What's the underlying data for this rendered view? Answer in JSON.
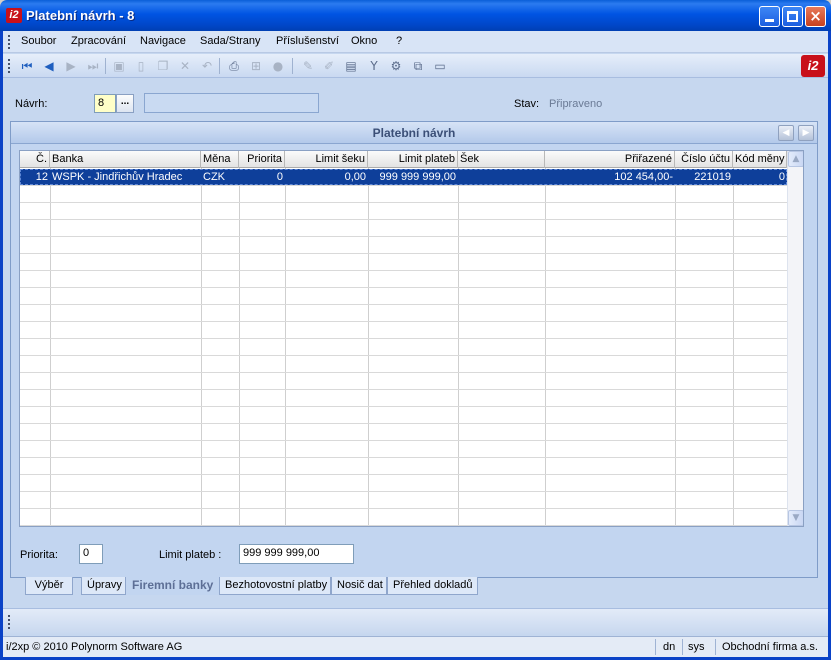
{
  "window": {
    "title": "Platební návrh - 8",
    "logo": "i2"
  },
  "menu": [
    "Soubor",
    "Zpracování",
    "Navigace",
    "Sada/Strany",
    "Příslušenství",
    "Okno",
    "?"
  ],
  "toolbar_icons": [
    "first-record-icon",
    "prev-record-icon",
    "next-record-icon",
    "last-record-icon",
    "save-icon",
    "new-icon",
    "copy-icon",
    "delete-icon",
    "undo-icon",
    "print-icon",
    "tree-icon",
    "refresh-icon",
    "edit-icon",
    "pencil-icon",
    "form-icon",
    "filter-icon",
    "settings-icon",
    "export-icon",
    "document-icon"
  ],
  "corner_logo": "i2",
  "header": {
    "navrh_label": "Návrh:",
    "navrh_value": "8",
    "dots": "...",
    "stav_label": "Stav:",
    "stav_value": "Připraveno"
  },
  "panel": {
    "title": "Platební návrh"
  },
  "grid": {
    "columns": [
      "Č.",
      "Banka",
      "Měna",
      "Priorita",
      "Limit šeku",
      "Limit plateb",
      "Šek",
      "Přiřazené",
      "Číslo účtu",
      "Kód měny"
    ],
    "rows": [
      [
        "12",
        "WSPK - Jindřichův Hradec",
        "CZK",
        "0",
        "0,00",
        "999 999 999,00",
        "",
        "102 454,00-",
        "221019",
        "0"
      ]
    ]
  },
  "footer_fields": {
    "priorita_label": "Priorita:",
    "priorita_value": "0",
    "limit_label": "Limit plateb :",
    "limit_value": "999 999 999,00"
  },
  "tabs": [
    "Výběr",
    "Úpravy",
    "Firemní banky",
    "Bezhotovostní platby",
    "Nosič dat",
    "Přehled dokladů"
  ],
  "active_tab": "Firemní banky",
  "statusbar": {
    "copyright": "i/2xp © 2010 Polynorm Software AG",
    "lang": "dn",
    "user": "sys",
    "company": "Obchodní firma a.s."
  }
}
